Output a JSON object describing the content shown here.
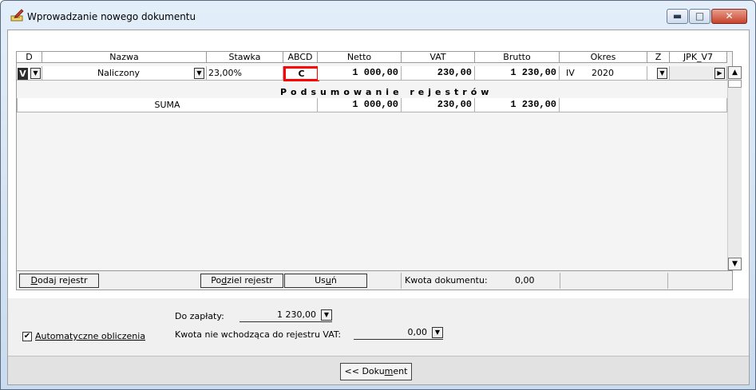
{
  "window": {
    "title": "Wprowadzanie nowego dokumentu",
    "minimize_glyph": "▬",
    "maximize_glyph": "□",
    "close_glyph": "✕"
  },
  "grid": {
    "headers": [
      "D",
      "Nazwa",
      "Stawka",
      "ABCD",
      "Netto",
      "VAT",
      "Brutto",
      "Okres",
      "Z",
      "JPK_V7"
    ],
    "row": {
      "d": "V",
      "nazwa": "Naliczony",
      "stawka": "23,00%",
      "abcd": "C",
      "netto": "1 000,00",
      "vat": "230,00",
      "brutto": "1 230,00",
      "okres_month": "IV",
      "okres_year": "2020",
      "z": "",
      "jpk": ""
    },
    "summary_title": "Podsumowanie rejestrów",
    "summary": {
      "label": "SUMA",
      "netto": "1 000,00",
      "vat": "230,00",
      "brutto": "1 230,00"
    }
  },
  "footer": {
    "add_label_u": "D",
    "add_label_rest": "odaj rejestr",
    "split_label_pre": "Po",
    "split_label_u": "d",
    "split_label_rest": "ziel rejestr",
    "delete_label_pre": "Us",
    "delete_label_u": "u",
    "delete_label_rest": "ń",
    "kwota_label": "Kwota dokumentu:",
    "kwota_value": "0,00"
  },
  "lower": {
    "do_zaplaty_label": "Do zapłaty:",
    "do_zaplaty_value": "1 230,00",
    "kwota_nie_label": "Kwota nie wchodząca do rejestru VAT:",
    "kwota_nie_value": "0,00",
    "auto_label": "Automatyczne obliczenia",
    "auto_checked_glyph": "✔"
  },
  "bottom": {
    "dokument_pre": "<< Doku",
    "dokument_u": "m",
    "dokument_rest": "ent"
  }
}
